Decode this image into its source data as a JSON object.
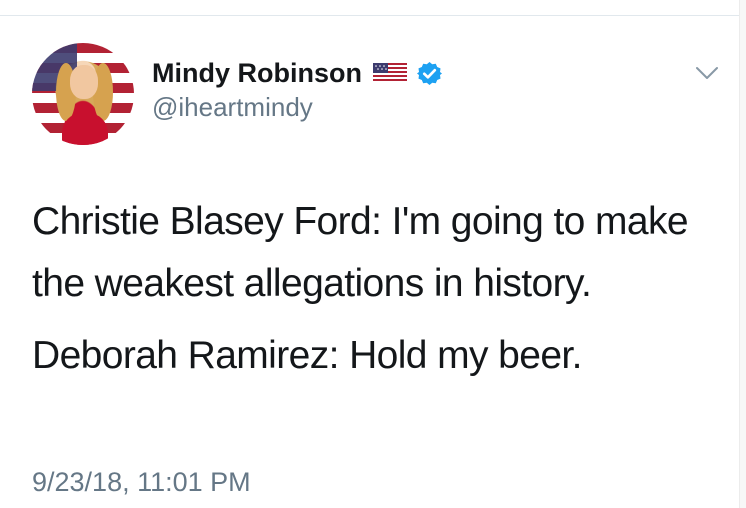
{
  "tweet": {
    "author": {
      "display_name": "Mindy Robinson",
      "handle": "@iheartmindy",
      "flag_icon": "us-flag-icon",
      "verified_icon": "verified-badge-icon"
    },
    "text_lines": [
      "Christie Blasey Ford: I'm going to make the weakest allegations in history.",
      "Deborah Ramirez: Hold my beer."
    ],
    "timestamp": "9/23/18, 11:01 PM",
    "menu_icon": "chevron-down-icon"
  },
  "colors": {
    "text": "#14171a",
    "secondary_text": "#657786",
    "verified_blue": "#1da1f2"
  }
}
